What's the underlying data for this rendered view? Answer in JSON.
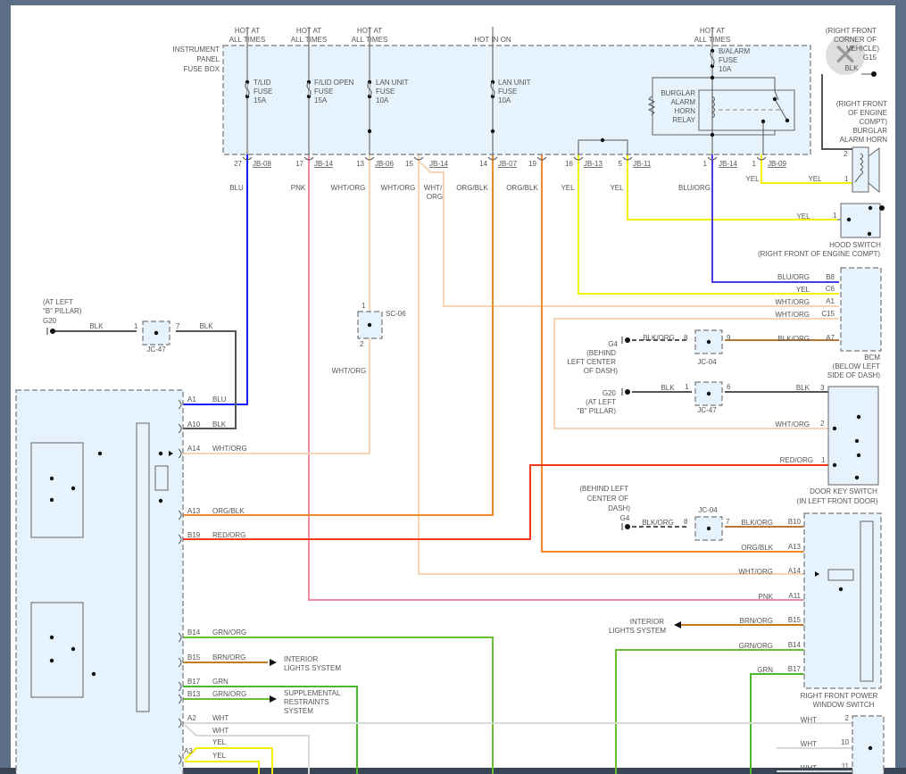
{
  "fuse_box": {
    "title": [
      "INSTRUMENT",
      "PANEL",
      "FUSE BOX"
    ],
    "hot": [
      {
        "l1": "HOT AT",
        "l2": "ALL TIMES"
      },
      {
        "l1": "HOT AT",
        "l2": "ALL TIMES"
      },
      {
        "l1": "HOT AT",
        "l2": "ALL TIMES"
      },
      {
        "l1": "",
        "l2": "HOT IN ON"
      },
      {
        "l1": "HOT AT",
        "l2": "ALL TIMES"
      }
    ],
    "fuses": [
      {
        "name": "T/LID",
        "type": "FUSE",
        "amp": "15A"
      },
      {
        "name": "F/LID OPEN",
        "type": "FUSE",
        "amp": "15A"
      },
      {
        "name": "LAN UNIT",
        "type": "FUSE",
        "amp": "10A"
      },
      {
        "name": "LAN UNIT",
        "type": "FUSE",
        "amp": "10A"
      },
      {
        "name": "B/ALARM",
        "type": "FUSE",
        "amp": "10A"
      }
    ],
    "relay": [
      "BURGLAR",
      "ALARM",
      "HORN",
      "RELAY"
    ],
    "pins": [
      {
        "num": "27",
        "conn": "JB-08"
      },
      {
        "num": "17",
        "conn": "JB-14"
      },
      {
        "num": "13",
        "conn": "JB-06"
      },
      {
        "num": "15",
        "conn": "JB-14"
      },
      {
        "num": "14",
        "conn": "JB-07"
      },
      {
        "num": "19",
        "conn": ""
      },
      {
        "num": "16",
        "conn": "JB-13"
      },
      {
        "num": "5",
        "conn": "JB-11"
      },
      {
        "num": "1",
        "conn": "JB-14"
      },
      {
        "num": "1",
        "conn": "JB-09"
      }
    ],
    "wire_labels": [
      "BLU",
      "PNK",
      "WHT/ORG",
      "WHT/ORG",
      "WHT/",
      "ORG",
      "ORG/BLK",
      "ORG/BLK",
      "YEL",
      "YEL",
      "BLU/ORG"
    ]
  },
  "horn": {
    "ground": [
      "(RIGHT FRONT",
      "CORNER OF",
      "VEHICLE)",
      "G15"
    ],
    "ground_wire": "BLK",
    "label": [
      "(RIGHT FRONT",
      "OF ENGINE",
      "COMPT)",
      "BURGLAR",
      "ALARM HORN"
    ],
    "pins": [
      "2",
      "1"
    ],
    "wires": [
      "YEL",
      "YEL"
    ]
  },
  "hood_switch": {
    "wire": "YEL",
    "pin": "1",
    "label": "HOOD SWITCH",
    "location": "(RIGHT FRONT OF ENGINE COMPT)"
  },
  "bcm": {
    "pins": [
      {
        "pin": "B8",
        "wire": "BLU/ORG"
      },
      {
        "pin": "C6",
        "wire": "YEL"
      },
      {
        "pin": "A1",
        "wire": "WHT/ORG"
      },
      {
        "pin": "C15",
        "wire": "WHT/ORG"
      },
      {
        "pin": "A7",
        "wire": "BLK/ORG"
      }
    ],
    "label": [
      "BCM",
      "(BELOW LEFT",
      "SIDE OF DASH)"
    ],
    "ground": {
      "name": "G4",
      "loc": [
        "(BEHIND",
        "LEFT CENTER",
        "OF DASH)"
      ],
      "wire": "BLK/ORG",
      "jc": "JC-04",
      "pin_in": "8",
      "pin_out": "9"
    }
  },
  "door_key": {
    "ground": {
      "name": "G20",
      "loc": [
        "(AT LEFT",
        "\"B\" PILLAR)"
      ],
      "wire": "BLK",
      "jc": "JC-47",
      "pin_in": "1",
      "pin_out": "6"
    },
    "pins": [
      {
        "pin": "3",
        "wire": "BLK"
      },
      {
        "pin": "2",
        "wire": "WHT/ORG"
      },
      {
        "pin": "1",
        "wire": "RED/ORG"
      }
    ],
    "label": [
      "DOOR KEY SWITCH",
      "(IN LEFT FRONT DOOR)"
    ]
  },
  "window_switch": {
    "ground": {
      "name": "G4",
      "loc": [
        "(BEHIND LEFT",
        "CENTER OF",
        "DASH)"
      ],
      "wire": "BLK/ORG",
      "jc": "JC-04",
      "pin_in": "8",
      "pin_out": "7"
    },
    "pins": [
      {
        "pin": "B10",
        "wire": "BLK/ORG"
      },
      {
        "pin": "A13",
        "wire": "ORG/BLK"
      },
      {
        "pin": "A14",
        "wire": "WHT/ORG"
      },
      {
        "pin": "A11",
        "wire": "PNK"
      },
      {
        "pin": "B15",
        "wire": "BRN/ORG"
      },
      {
        "pin": "B14",
        "wire": "GRN/ORG"
      },
      {
        "pin": "B17",
        "wire": "GRN"
      }
    ],
    "interior": [
      "INTERIOR",
      "LIGHTS SYSTEM"
    ],
    "label": [
      "RIGHT FRONT POWER",
      "WINDOW SWITCH"
    ]
  },
  "bottom_right": {
    "pins": [
      {
        "pin": "2",
        "wire": "WHT"
      },
      {
        "pin": "10",
        "wire": "WHT"
      },
      {
        "pin": "11",
        "wire": "WHT"
      }
    ]
  },
  "left_ground": {
    "loc": [
      "(AT LEFT",
      "\"B\" PILLAR)",
      "G20"
    ],
    "wire_in": "BLK",
    "wire_out": "BLK",
    "jc": "JC-47",
    "pin_in": "1",
    "pin_out": "7"
  },
  "sc06": {
    "name": "SC-06",
    "pin_top": "1",
    "pin_bottom": "2",
    "wire": "WHT/ORG"
  },
  "left_module": {
    "pins": [
      {
        "pin": "A1",
        "wire": "BLU"
      },
      {
        "pin": "A10",
        "wire": "BLK"
      },
      {
        "pin": "A14",
        "wire": "WHT/ORG"
      },
      {
        "pin": "A13",
        "wire": "ORG/BLK"
      },
      {
        "pin": "B19",
        "wire": "RED/ORG"
      },
      {
        "pin": "B14",
        "wire": "GRN/ORG"
      },
      {
        "pin": "B15",
        "wire": "BRN/ORG"
      },
      {
        "pin": "B17",
        "wire": "GRN"
      },
      {
        "pin": "B13",
        "wire": "GRN/ORG"
      },
      {
        "pin": "A2",
        "wire": "WHT"
      },
      {
        "pin": "",
        "wire": "WHT"
      },
      {
        "pin": "",
        "wire": "YEL"
      },
      {
        "pin": "A3",
        "wire": "YEL"
      }
    ],
    "interior": [
      "INTERIOR",
      "LIGHTS SYSTEM"
    ],
    "srs": [
      "SUPPLEMENTAL",
      "RESTRAINTS",
      "SYSTEM"
    ]
  },
  "colors": {
    "BLU": "#1a1aff",
    "PNK": "#f08aa0",
    "WHTORG": "#f5d5b5",
    "ORGBLK": "#f58a2a",
    "YEL": "#f4f000",
    "BLUORG": "#4a3ce0",
    "BLK": "#555555",
    "REDORG": "#f53a1a",
    "BRNORG": "#c8781e",
    "GRN": "#4db82a",
    "GRNORG": "#6abf30",
    "WHT": "#d8d8d8",
    "BLKORG": "#b8783a"
  }
}
